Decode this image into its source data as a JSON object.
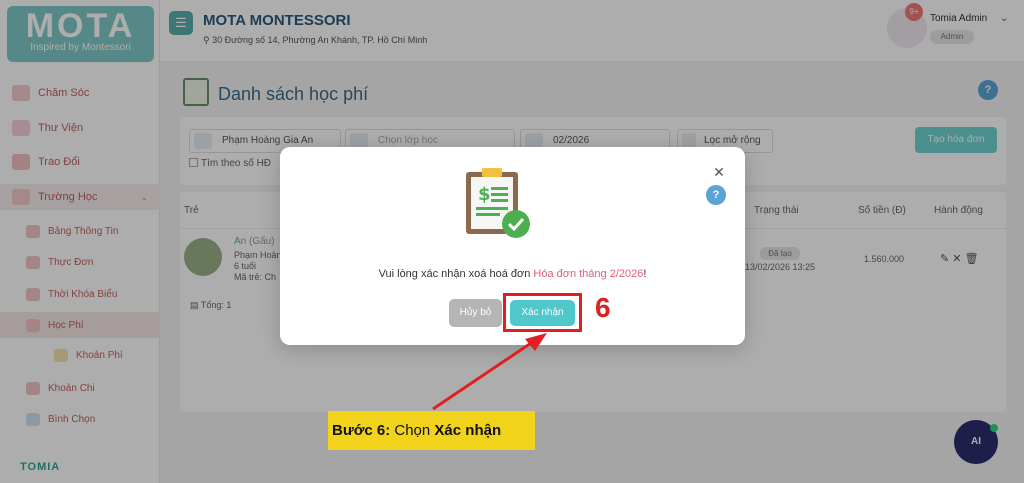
{
  "sidebar": {
    "logo_main": "MOTA",
    "logo_sub": "Inspired by Montessori",
    "items": [
      {
        "label": "Chăm Sóc"
      },
      {
        "label": "Thư Viện"
      },
      {
        "label": "Trao Đổi"
      },
      {
        "label": "Trường Học"
      }
    ],
    "sub_items": [
      {
        "label": "Bảng Thông Tin"
      },
      {
        "label": "Thực Đơn"
      },
      {
        "label": "Thời Khóa Biểu"
      },
      {
        "label": "Học Phí"
      },
      {
        "label": "Khoản Phí"
      },
      {
        "label": "Khoản Chi"
      },
      {
        "label": "Bình Chọn"
      }
    ],
    "brand": "TOMIA"
  },
  "header": {
    "school_name": "MOTA MONTESSORI",
    "address": "30 Đường số 14, Phường An Khánh, TP. Hồ Chí Minh",
    "notification_count": "9+",
    "user_name": "Tomia Admin",
    "user_role": "Admin"
  },
  "main": {
    "page_title": "Danh sách học phí",
    "filters": {
      "student": "Phạm Hoàng Gia An",
      "class_placeholder": "Chọn lớp học",
      "month": "02/2026",
      "advanced": "Lọc mở rộng",
      "search_by_code": "Tìm theo số HĐ"
    },
    "create_button": "Tạo hóa đơn",
    "table": {
      "headers": [
        "Trẻ",
        "Trạng thái",
        "Số tiền (Đ)",
        "Hành động"
      ],
      "row": {
        "name": "An",
        "nickname": "(Gấu)",
        "full_name": "Phạm Hoàn",
        "age": "6 tuổi",
        "code": "Mã trẻ: Ch",
        "status": "Đã tạo",
        "date": "13/02/2026 13:25",
        "amount": "1.560.000"
      },
      "total": "Tổng: 1"
    }
  },
  "modal": {
    "message_prefix": "Vui lòng xác nhận xoá hoá đơn",
    "message_highlight": "Hóa đơn tháng 2/2026",
    "message_suffix": "!",
    "cancel": "Hủy bỏ",
    "confirm": "Xác nhận"
  },
  "annotation": {
    "step_number": "6",
    "callout_prefix": "Bước 6:",
    "callout_text": " Chọn ",
    "callout_bold": "Xác nhận"
  },
  "ai_button": "AI",
  "colors": {
    "accent": "#4fc7cb",
    "highlight": "#e0607a",
    "annotation_red": "#e02020",
    "callout_yellow": "#f2d31b"
  }
}
